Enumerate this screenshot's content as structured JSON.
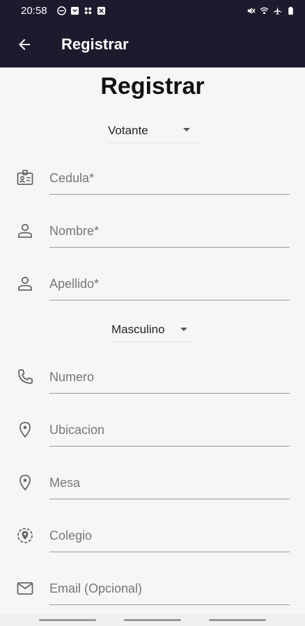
{
  "status_bar": {
    "time": "20:58",
    "left_icons": [
      "do-not-disturb-icon",
      "notification-icon",
      "grid-icon",
      "notification-x-icon"
    ],
    "right_icons": [
      "mute-icon",
      "wifi-icon",
      "airplane-icon",
      "battery-icon"
    ]
  },
  "app_bar": {
    "title": "Registrar",
    "back_icon": "arrow-left-icon"
  },
  "form": {
    "heading": "Registrar",
    "type_dropdown": {
      "value": "Votante"
    },
    "gender_dropdown": {
      "value": "Masculino"
    },
    "fields": [
      {
        "placeholder": "Cedula*",
        "icon": "id-badge-icon"
      },
      {
        "placeholder": "Nombre*",
        "icon": "person-icon"
      },
      {
        "placeholder": "Apellido*",
        "icon": "person-icon"
      },
      {
        "placeholder": "Numero",
        "icon": "phone-icon"
      },
      {
        "placeholder": "Ubicacion",
        "icon": "location-pin-icon"
      },
      {
        "placeholder": "Mesa",
        "icon": "location-pin-icon"
      },
      {
        "placeholder": "Colegio",
        "icon": "location-searching-icon"
      },
      {
        "placeholder": "Email (Opcional)",
        "icon": "mail-icon"
      }
    ]
  },
  "colors": {
    "app_bar": "#1c1b2e",
    "background": "#f6f6f6",
    "underline": "#9a9a9a",
    "icon": "#666666"
  }
}
